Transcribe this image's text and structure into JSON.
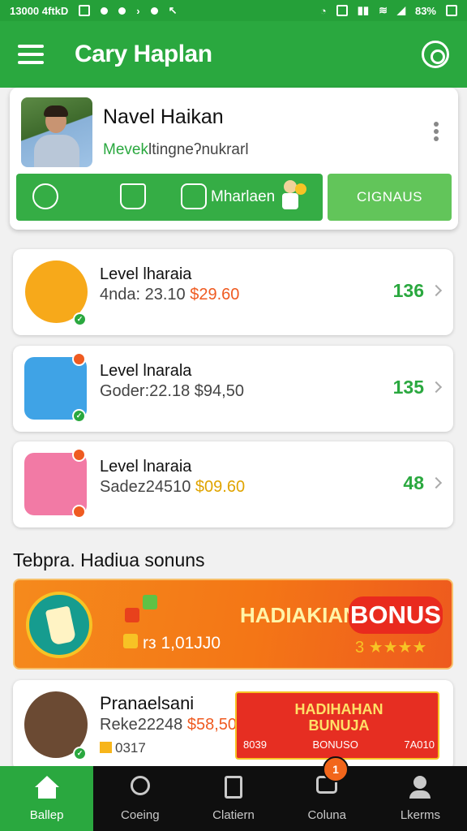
{
  "status_bar": {
    "time": "13000 4ftkD",
    "battery": "83%"
  },
  "app_bar": {
    "title": "Cary Haplan",
    "menu_icon": "hamburger-menu-icon",
    "action_icon": "settings-icon"
  },
  "profile": {
    "name": "Navel Haikan",
    "subtitle_green": "Mevek",
    "subtitle_rest": "ltingneʔnukrarl",
    "action_label": "Mharlaen",
    "bonus_button": "CIGNAUS"
  },
  "levels": [
    {
      "title": "Level lharaia",
      "sub_prefix": "4nda:",
      "sub_code": "23.10",
      "price": "$29.60",
      "count": "136",
      "price_color": "#ef5b21"
    },
    {
      "title": "Level lnarala",
      "sub_prefix": "Goder:",
      "sub_code": "22.18",
      "price": "$94,50",
      "count": "135",
      "price_color": "#444444"
    },
    {
      "title": "Level lnaraia",
      "sub_prefix": "Sadez",
      "sub_code": "24510",
      "price": "$09.60",
      "count": "48",
      "price_color": "#e0a400"
    }
  ],
  "section_title": "Tebpra. Hadiua sonuns",
  "banner": {
    "amount": "rз 1,01JJ0",
    "headline": "HADIAKIAN",
    "pill": "BONUS",
    "rating": "3 ★★★★"
  },
  "promo_card": {
    "title": "Pranaelsani",
    "sub_prefix": "Reke22248",
    "price": "$58,50",
    "count": "0317",
    "promo_title": "HADIHAHAN BUNUJA",
    "promo_left": "8039",
    "promo_mid": "BONUSO",
    "promo_right": "7A010"
  },
  "bottom_nav": {
    "items": [
      {
        "label": "Ballep",
        "icon": "home-icon"
      },
      {
        "label": "Coeing",
        "icon": "search-icon"
      },
      {
        "label": "Clatiern",
        "icon": "clipboard-icon"
      },
      {
        "label": "Coluna",
        "icon": "chat-icon"
      },
      {
        "label": "Lkerms",
        "icon": "person-icon"
      }
    ],
    "badge": "1"
  },
  "colors": {
    "brand_green": "#2aa83f",
    "accent_orange": "#ef5b21",
    "bonus_red": "#e92a1e"
  }
}
